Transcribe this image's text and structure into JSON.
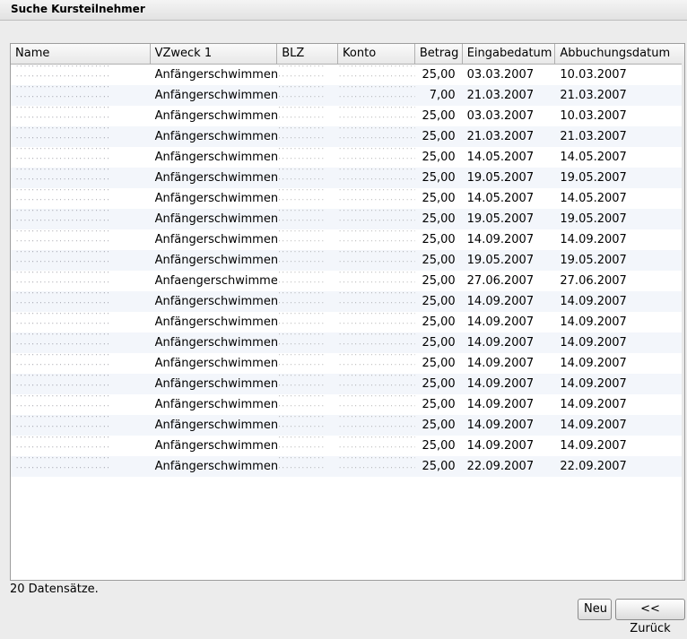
{
  "window": {
    "title": "Suche Kursteilnehmer"
  },
  "table": {
    "columns": [
      "Name",
      "VZweck 1",
      "BLZ",
      "Konto",
      "Betrag",
      "Eingabedatum",
      "Abbuchungsdatum"
    ],
    "rows": [
      {
        "vzweck": "Anfängerschwimmen",
        "betrag": "25,00",
        "eingabe": "03.03.2007",
        "abbuchung": "10.03.2007"
      },
      {
        "vzweck": "Anfängerschwimmen",
        "betrag": "7,00",
        "eingabe": "21.03.2007",
        "abbuchung": "21.03.2007"
      },
      {
        "vzweck": "Anfängerschwimmen",
        "betrag": "25,00",
        "eingabe": "03.03.2007",
        "abbuchung": "10.03.2007"
      },
      {
        "vzweck": "Anfängerschwimmen",
        "betrag": "25,00",
        "eingabe": "21.03.2007",
        "abbuchung": "21.03.2007"
      },
      {
        "vzweck": "Anfängerschwimmen",
        "betrag": "25,00",
        "eingabe": "14.05.2007",
        "abbuchung": "14.05.2007"
      },
      {
        "vzweck": "Anfängerschwimmen",
        "betrag": "25,00",
        "eingabe": "19.05.2007",
        "abbuchung": "19.05.2007"
      },
      {
        "vzweck": "Anfängerschwimmen",
        "betrag": "25,00",
        "eingabe": "14.05.2007",
        "abbuchung": "14.05.2007"
      },
      {
        "vzweck": "Anfängerschwimmen",
        "betrag": "25,00",
        "eingabe": "19.05.2007",
        "abbuchung": "19.05.2007"
      },
      {
        "vzweck": "Anfängerschwimmen",
        "betrag": "25,00",
        "eingabe": "14.09.2007",
        "abbuchung": "14.09.2007"
      },
      {
        "vzweck": "Anfängerschwimmen",
        "betrag": "25,00",
        "eingabe": "19.05.2007",
        "abbuchung": "19.05.2007"
      },
      {
        "vzweck": "Anfaengerschwimmen",
        "betrag": "25,00",
        "eingabe": "27.06.2007",
        "abbuchung": "27.06.2007"
      },
      {
        "vzweck": "Anfängerschwimmen",
        "betrag": "25,00",
        "eingabe": "14.09.2007",
        "abbuchung": "14.09.2007"
      },
      {
        "vzweck": "Anfängerschwimmen",
        "betrag": "25,00",
        "eingabe": "14.09.2007",
        "abbuchung": "14.09.2007"
      },
      {
        "vzweck": "Anfängerschwimmen",
        "betrag": "25,00",
        "eingabe": "14.09.2007",
        "abbuchung": "14.09.2007"
      },
      {
        "vzweck": "Anfängerschwimmen",
        "betrag": "25,00",
        "eingabe": "14.09.2007",
        "abbuchung": "14.09.2007"
      },
      {
        "vzweck": "Anfängerschwimmen",
        "betrag": "25,00",
        "eingabe": "14.09.2007",
        "abbuchung": "14.09.2007"
      },
      {
        "vzweck": "Anfängerschwimmen",
        "betrag": "25,00",
        "eingabe": "14.09.2007",
        "abbuchung": "14.09.2007"
      },
      {
        "vzweck": "Anfängerschwimmen",
        "betrag": "25,00",
        "eingabe": "14.09.2007",
        "abbuchung": "14.09.2007"
      },
      {
        "vzweck": "Anfängerschwimmen",
        "betrag": "25,00",
        "eingabe": "14.09.2007",
        "abbuchung": "14.09.2007"
      },
      {
        "vzweck": "Anfängerschwimmen",
        "betrag": "25,00",
        "eingabe": "22.09.2007",
        "abbuchung": "22.09.2007"
      }
    ]
  },
  "status": {
    "count_text": "20 Datensätze."
  },
  "buttons": {
    "new_label": "Neu",
    "back_label": "<< Zurück"
  }
}
